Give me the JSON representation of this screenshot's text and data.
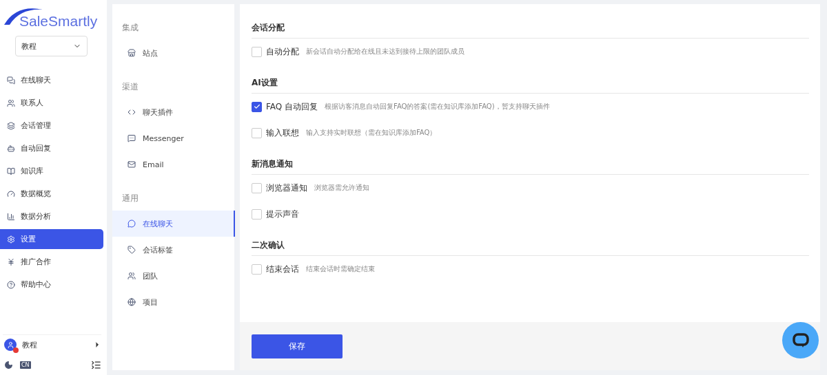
{
  "sidebar": {
    "logo": "SaleSmartly",
    "workspace": "教程",
    "items": [
      {
        "label": "在线聊天",
        "selected": false
      },
      {
        "label": "联系人",
        "selected": false
      },
      {
        "label": "会话管理",
        "selected": false
      },
      {
        "label": "自动回复",
        "selected": false
      },
      {
        "label": "知识库",
        "selected": false
      },
      {
        "label": "数据概览",
        "selected": false
      },
      {
        "label": "数据分析",
        "selected": false
      },
      {
        "label": "设置",
        "selected": true
      },
      {
        "label": "推广合作",
        "selected": false
      },
      {
        "label": "帮助中心",
        "selected": false
      }
    ],
    "user": "教程",
    "language": "CN"
  },
  "settings_menu": [
    {
      "title": "集成",
      "items": [
        {
          "label": "站点",
          "selected": false
        }
      ]
    },
    {
      "title": "渠道",
      "items": [
        {
          "label": "聊天插件",
          "selected": false
        },
        {
          "label": "Messenger",
          "selected": false
        },
        {
          "label": "Email",
          "selected": false
        }
      ]
    },
    {
      "title": "通用",
      "items": [
        {
          "label": "在线聊天",
          "selected": true
        },
        {
          "label": "会话标签",
          "selected": false
        },
        {
          "label": "团队",
          "selected": false
        },
        {
          "label": "项目",
          "selected": false
        }
      ]
    }
  ],
  "sections": [
    {
      "title": "会话分配",
      "options": [
        {
          "label": "自动分配",
          "description": "新会话自动分配给在线且未达到接待上限的团队成员",
          "checked": false
        }
      ]
    },
    {
      "title": "AI设置",
      "options": [
        {
          "label": "FAQ 自动回复",
          "description": "根据访客消息自动回复FAQ的答案(需在知识库添加FAQ)，暂支持聊天插件",
          "checked": true
        },
        {
          "label": "输入联想",
          "description": "输入支持实时联想（需在知识库添加FAQ）",
          "checked": false
        }
      ]
    },
    {
      "title": "新消息通知",
      "options": [
        {
          "label": "浏览器通知",
          "description": "浏览器需允许通知",
          "checked": false
        },
        {
          "label": "提示声音",
          "checked": false
        }
      ]
    },
    {
      "title": "二次确认",
      "options": [
        {
          "label": "结束会话",
          "description": "结束会话时需确定结束",
          "checked": false
        }
      ]
    }
  ],
  "save_button": "保存"
}
